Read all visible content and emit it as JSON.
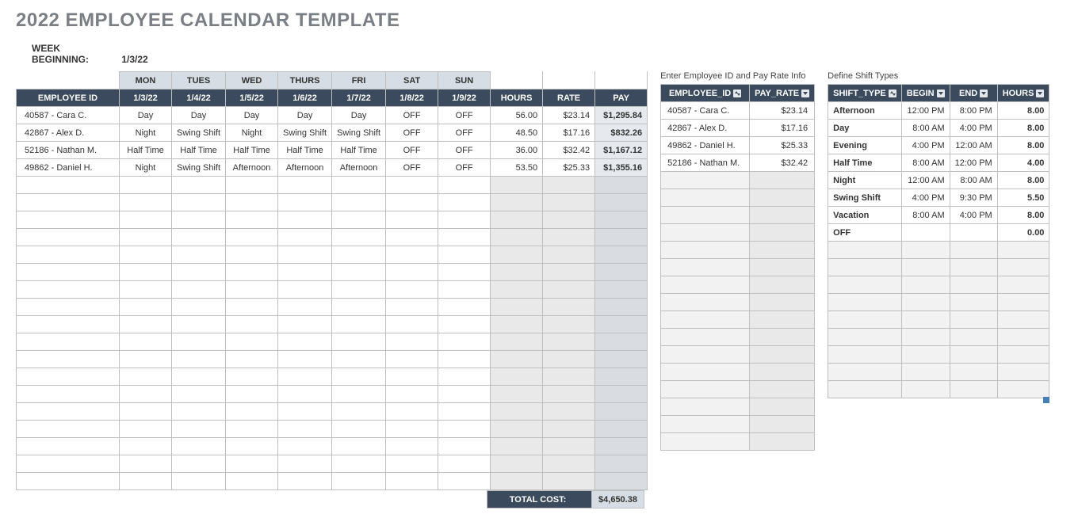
{
  "title": "2022 EMPLOYEE CALENDAR TEMPLATE",
  "week": {
    "label": "WEEK BEGINNING:",
    "value": "1/3/22"
  },
  "main": {
    "day_headers_blank": "",
    "day_names": [
      "MON",
      "TUES",
      "WED",
      "THURS",
      "FRI",
      "SAT",
      "SUN"
    ],
    "headers": {
      "emp": "EMPLOYEE ID",
      "d0": "1/3/22",
      "d1": "1/4/22",
      "d2": "1/5/22",
      "d3": "1/6/22",
      "d4": "1/7/22",
      "d5": "1/8/22",
      "d6": "1/9/22",
      "hours": "HOURS",
      "rate": "RATE",
      "pay": "PAY"
    },
    "rows": [
      {
        "emp": "40587 - Cara C.",
        "d": [
          "Day",
          "Day",
          "Day",
          "Day",
          "Day",
          "OFF",
          "OFF"
        ],
        "hours": "56.00",
        "rate": "$23.14",
        "pay": "$1,295.84"
      },
      {
        "emp": "42867 - Alex D.",
        "d": [
          "Night",
          "Swing Shift",
          "Night",
          "Swing Shift",
          "Swing Shift",
          "OFF",
          "OFF"
        ],
        "hours": "48.50",
        "rate": "$17.16",
        "pay": "$832.26"
      },
      {
        "emp": "52186 - Nathan M.",
        "d": [
          "Half Time",
          "Half Time",
          "Half Time",
          "Half Time",
          "Half Time",
          "OFF",
          "OFF"
        ],
        "hours": "36.00",
        "rate": "$32.42",
        "pay": "$1,167.12"
      },
      {
        "emp": "49862 - Daniel H.",
        "d": [
          "Night",
          "Swing Shift",
          "Afternoon",
          "Afternoon",
          "Afternoon",
          "OFF",
          "OFF"
        ],
        "hours": "53.50",
        "rate": "$25.33",
        "pay": "$1,355.16"
      }
    ],
    "empty_rows": 18,
    "total": {
      "label": "TOTAL COST:",
      "value": "$4,650.38"
    }
  },
  "empinfo": {
    "label": "Enter Employee ID and Pay Rate Info",
    "headers": {
      "id": "EMPLOYEE_ID",
      "rate": "PAY_RATE"
    },
    "rows": [
      {
        "id": "40587 - Cara C.",
        "rate": "$23.14"
      },
      {
        "id": "42867 - Alex D.",
        "rate": "$17.16"
      },
      {
        "id": "49862 - Daniel H.",
        "rate": "$25.33"
      },
      {
        "id": "52186 - Nathan M.",
        "rate": "$32.42"
      }
    ],
    "empty_rows": 16
  },
  "shifts": {
    "label": "Define Shift Types",
    "headers": {
      "type": "SHIFT_TYPE",
      "begin": "BEGIN",
      "end": "END",
      "hours": "HOURS"
    },
    "rows": [
      {
        "type": "Afternoon",
        "begin": "12:00 PM",
        "end": "8:00 PM",
        "hours": "8.00"
      },
      {
        "type": "Day",
        "begin": "8:00 AM",
        "end": "4:00 PM",
        "hours": "8.00"
      },
      {
        "type": "Evening",
        "begin": "4:00 PM",
        "end": "12:00 AM",
        "hours": "8.00"
      },
      {
        "type": "Half Time",
        "begin": "8:00 AM",
        "end": "12:00 PM",
        "hours": "4.00"
      },
      {
        "type": "Night",
        "begin": "12:00 AM",
        "end": "8:00 AM",
        "hours": "8.00"
      },
      {
        "type": "Swing Shift",
        "begin": "4:00 PM",
        "end": "9:30 PM",
        "hours": "5.50"
      },
      {
        "type": "Vacation",
        "begin": "8:00 AM",
        "end": "4:00 PM",
        "hours": "8.00"
      },
      {
        "type": "OFF",
        "begin": "",
        "end": "",
        "hours": "0.00"
      }
    ],
    "empty_rows": 9
  }
}
